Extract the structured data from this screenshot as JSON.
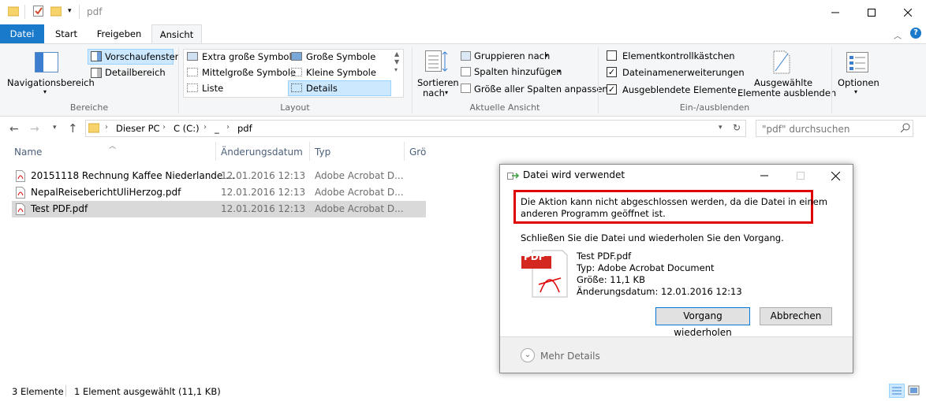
{
  "window": {
    "title": "pdf"
  },
  "tabs": [
    {
      "label": "Datei"
    },
    {
      "label": "Start"
    },
    {
      "label": "Freigeben"
    },
    {
      "label": "Ansicht"
    }
  ],
  "ribbon": {
    "bereiche": {
      "nav": "Navigationsbereich",
      "preview": "Vorschaufenster",
      "details": "Detailbereich",
      "label": "Bereiche"
    },
    "layout": {
      "items": [
        "Extra große Symbole",
        "Große Symbole",
        "Mittelgroße Symbole",
        "Kleine Symbole",
        "Liste",
        "Details"
      ],
      "label": "Layout"
    },
    "ansicht": {
      "sort1": "Sortieren",
      "sort2": "nach",
      "group": "Gruppieren nach",
      "addcol": "Spalten hinzufügen",
      "fit": "Größe aller Spalten anpassen",
      "label": "Aktuelle Ansicht"
    },
    "einaus": {
      "cb1": "Elementkontrollkästchen",
      "cb2": "Dateinamenerweiterungen",
      "cb3": "Ausgeblendete Elemente",
      "hide1": "Ausgewählte",
      "hide2": "Elemente ausblenden",
      "label": "Ein-/ausblenden"
    },
    "options": "Optionen"
  },
  "address": {
    "crumbs": [
      "Dieser PC",
      "C (C:)",
      "_",
      "pdf"
    ],
    "search_placeholder": "\"pdf\" durchsuchen"
  },
  "columns": [
    "Name",
    "Änderungsdatum",
    "Typ",
    "Grö"
  ],
  "files": [
    {
      "name": "20151118 Rechnung Kaffee Niederlande....",
      "date": "12.01.2016 12:13",
      "type": "Adobe Acrobat D..."
    },
    {
      "name": "NepalReiseberichtUliHerzog.pdf",
      "date": "12.01.2016 12:13",
      "type": "Adobe Acrobat D..."
    },
    {
      "name": "Test PDF.pdf",
      "date": "12.01.2016 12:13",
      "type": "Adobe Acrobat D..."
    }
  ],
  "status": {
    "count": "3 Elemente",
    "selected": "1 Element ausgewählt (11,1 KB)"
  },
  "dialog": {
    "title": "Datei wird verwendet",
    "msg1": "Die Aktion kann nicht abgeschlossen werden, da die Datei in einem",
    "msg2": "anderen Programm geöffnet ist.",
    "instruction": "Schließen Sie die Datei und wiederholen Sie den Vorgang.",
    "file_name": "Test PDF.pdf",
    "file_type": "Typ: Adobe Acrobat Document",
    "file_size": "Größe: 11,1 KB",
    "file_date": "Änderungsdatum: 12.01.2016 12:13",
    "pdf_label": "PDF",
    "retry": "Vorgang wiederholen",
    "cancel": "Abbrechen",
    "more": "Mehr Details"
  },
  "colors": {
    "accent": "#1979ca",
    "highlight": "#e00000",
    "selection": "#d9d9d9"
  }
}
